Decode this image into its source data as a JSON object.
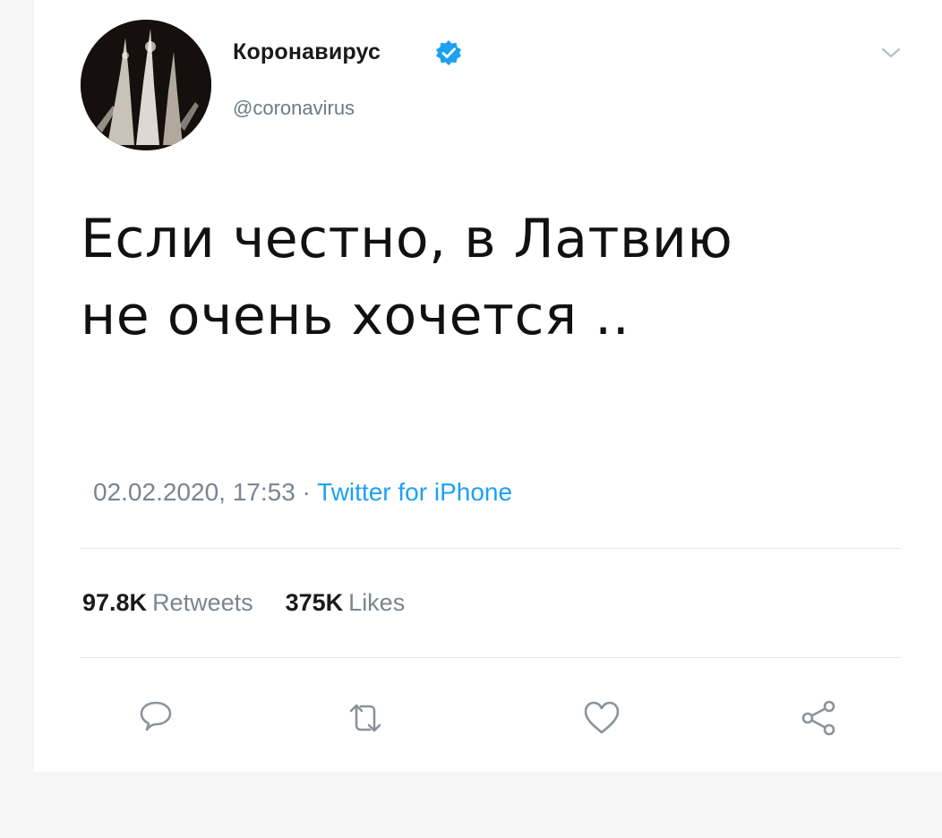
{
  "user": {
    "display_name": "Коронавирус",
    "handle": "@coronavirus",
    "verified": true,
    "avatar": "avatar-image"
  },
  "tweet": {
    "text_line1": "Если честно, в Латвию",
    "text_line2": "не очень хочется .."
  },
  "meta": {
    "timestamp": "02.02.2020, 17:53",
    "separator": "·",
    "source": "Twitter for iPhone"
  },
  "stats": {
    "retweets_count": "97.8K",
    "retweets_label": "Retweets",
    "likes_count": "375K",
    "likes_label": "Likes"
  },
  "actions": [
    {
      "icon": "reply-icon"
    },
    {
      "icon": "retweet-icon"
    },
    {
      "icon": "heart-icon"
    },
    {
      "icon": "share-icon"
    }
  ],
  "colors": {
    "accent": "#1da1f2",
    "muted": "#7a8590",
    "text": "#111111"
  }
}
